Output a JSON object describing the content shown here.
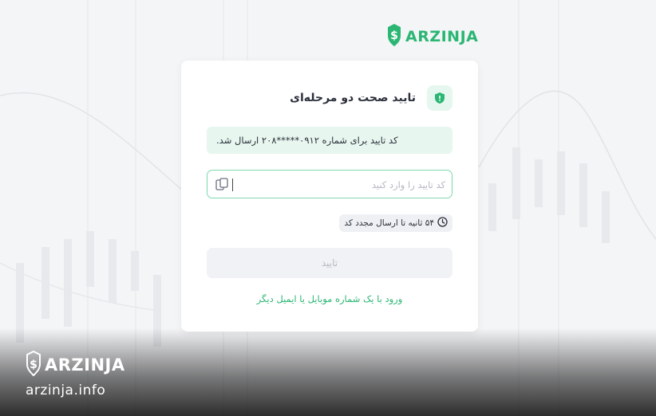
{
  "brand": {
    "name": "ARZINJA",
    "accent": "#2bb673",
    "url": "arzinja.info"
  },
  "card": {
    "title": "تایید صحت دو مرحله‌ای",
    "info_message": "کد تایید برای شماره ۰۹۱۲*****۲۰۸ ارسال شد.",
    "otp": {
      "placeholder": "کد تایید را وارد کنید",
      "value": ""
    },
    "timer_label": "۵۴ ثانیه تا ارسال مجدد کد",
    "confirm_label": "تایید",
    "alt_login_label": "ورود با یک شماره موبایل یا ایمیل دیگر"
  },
  "icons": {
    "header": "shield-icon",
    "paste": "clipboard-icon",
    "timer": "clock-icon",
    "logo": "dollar-shield-icon"
  }
}
